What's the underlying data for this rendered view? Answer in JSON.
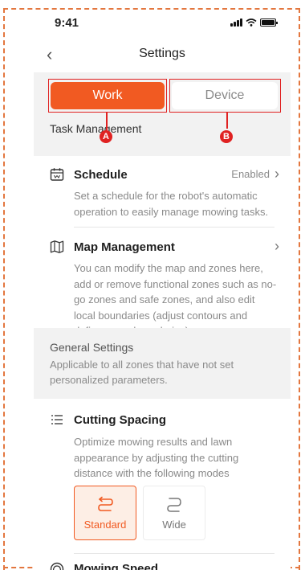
{
  "status_bar": {
    "time": "9:41"
  },
  "nav": {
    "back_glyph": "‹",
    "title": "Settings"
  },
  "tabs": [
    {
      "label": "Work",
      "selected": true,
      "marker": "A"
    },
    {
      "label": "Device",
      "selected": false,
      "marker": "B"
    }
  ],
  "task_management": {
    "heading": "Task Management",
    "schedule": {
      "icon": "calendar-icon",
      "title": "Schedule",
      "status": "Enabled",
      "description": "Set a schedule for the robot's automatic operation to easily manage mowing tasks."
    },
    "map": {
      "icon": "map-icon",
      "title": "Map Management",
      "description": "You can modify the map and zones here, add or remove functional zones such as no-go zones and safe zones, and also edit local boundaries (adjust contours and define cross-boundaries)."
    }
  },
  "general_settings": {
    "title": "General Settings",
    "description": "Applicable to all zones that have not set personalized parameters."
  },
  "cutting_spacing": {
    "icon": "list-icon",
    "title": "Cutting Spacing",
    "description": "Optimize mowing results and lawn appearance by adjusting the cutting distance with the following modes",
    "modes": [
      {
        "label": "Standard",
        "selected": true,
        "icon": "standard-path-icon"
      },
      {
        "label": "Wide",
        "selected": false,
        "icon": "wide-path-icon"
      }
    ]
  },
  "mowing_speed": {
    "icon": "speedometer-icon",
    "title": "Mowing Speed"
  },
  "colors": {
    "accent": "#f15a22",
    "annotation": "#e02222",
    "frame_dash": "#e3773f",
    "section_bg": "#f2f2f2"
  }
}
